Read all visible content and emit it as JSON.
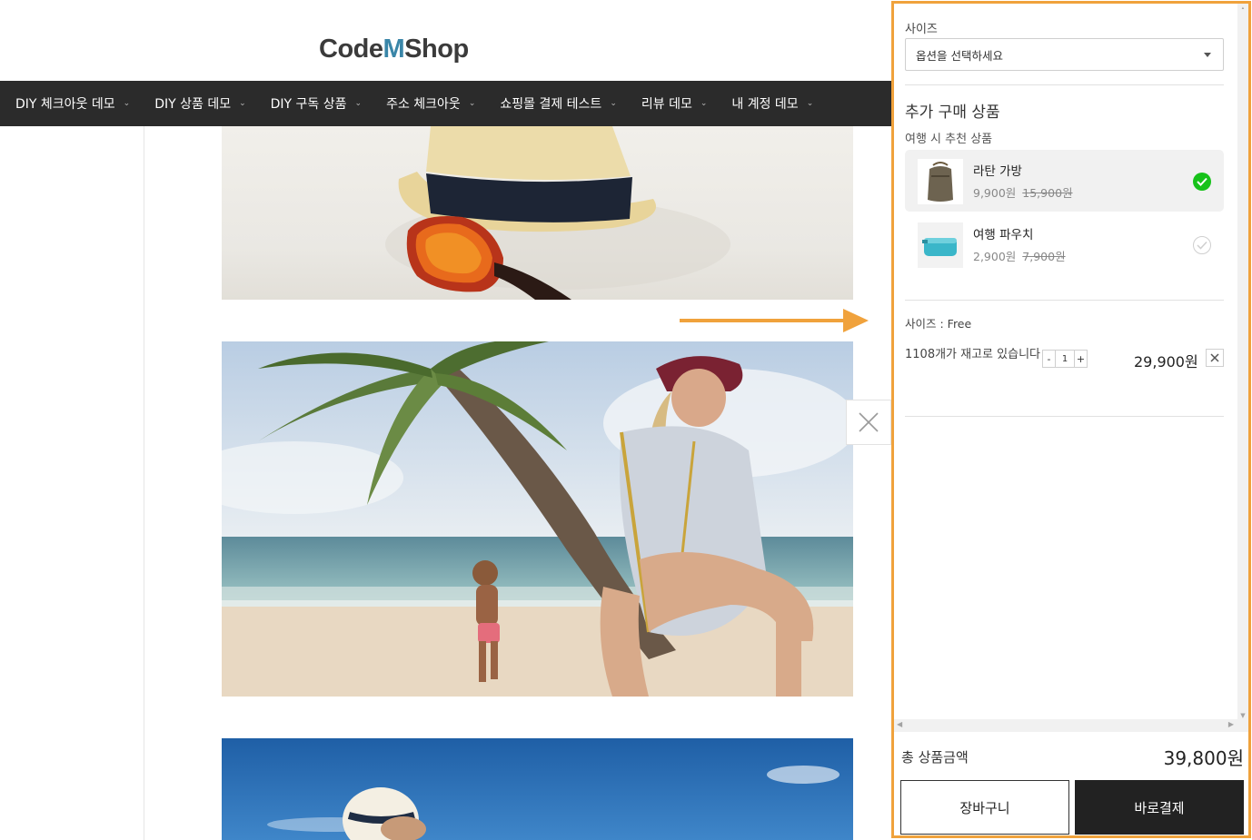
{
  "header": {
    "logo_left": "Code",
    "logo_mid": "M",
    "logo_right": "Shop"
  },
  "nav": {
    "items": [
      {
        "label": "DIY 체크아웃 데모"
      },
      {
        "label": "DIY 상품 데모"
      },
      {
        "label": "DIY 구독 상품"
      },
      {
        "label": "주소 체크아웃"
      },
      {
        "label": "쇼핑몰 결제 테스트"
      },
      {
        "label": "리뷰 데모"
      },
      {
        "label": "내 계정 데모"
      }
    ]
  },
  "panel": {
    "size_label": "사이즈",
    "size_select_value": "옵션을 선택하세요",
    "addons_title": "추가 구매 상품",
    "addons_subtitle": "여행 시 추천 상품",
    "addons": [
      {
        "name": "라탄 가방",
        "price": "9,900원",
        "original_price": "15,900원",
        "selected": true
      },
      {
        "name": "여행 파우치",
        "price": "2,900원",
        "original_price": "7,900원",
        "selected": false
      }
    ],
    "selected_option": {
      "name": "사이즈 : Free",
      "stock": "1108개가 재고로 있습니다",
      "quantity": "1",
      "minus": "-",
      "plus": "+",
      "price": "29,900원"
    },
    "total_label": "총 상품금액",
    "total_value": "39,800원",
    "cart_button": "장바구니",
    "buy_button": "바로결제"
  },
  "colors": {
    "nav_bg": "#2b2b2b",
    "panel_highlight": "#f0a23c",
    "check_green": "#17c21a",
    "buy_bg": "#222222"
  }
}
